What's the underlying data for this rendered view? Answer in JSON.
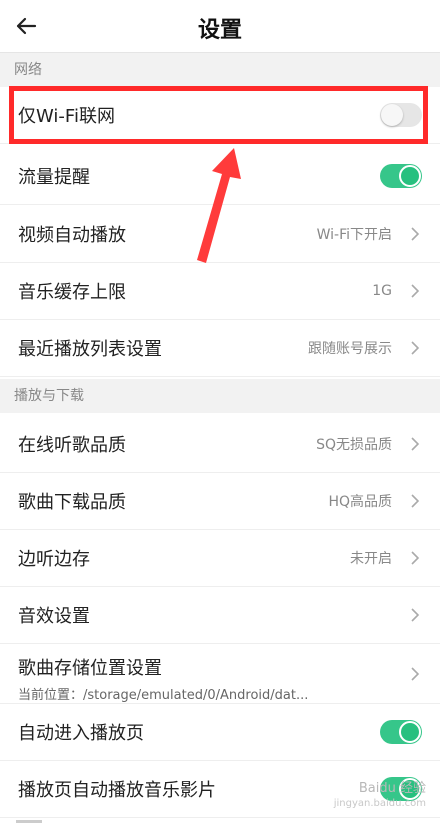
{
  "header": {
    "title": "设置"
  },
  "sections": {
    "network": {
      "label": "网络"
    },
    "playback": {
      "label": "播放与下载"
    }
  },
  "rows": {
    "wifi_only": {
      "label": "仅Wi-Fi联网",
      "toggle": "off"
    },
    "data_alert": {
      "label": "流量提醒",
      "toggle": "on"
    },
    "video_autoplay": {
      "label": "视频自动播放",
      "value": "Wi-Fi下开启"
    },
    "cache_limit": {
      "label": "音乐缓存上限",
      "value": "1G"
    },
    "recent_list": {
      "label": "最近播放列表设置",
      "value": "跟随账号展示"
    },
    "online_quality": {
      "label": "在线听歌品质",
      "value": "SQ无损品质"
    },
    "download_quality": {
      "label": "歌曲下载品质",
      "value": "HQ高品质"
    },
    "cache_while_play": {
      "label": "边听边存",
      "value": "未开启"
    },
    "sound_effects": {
      "label": "音效设置"
    },
    "storage_location": {
      "label": "歌曲存储位置设置",
      "sub": "当前位置：/storage/emulated/0/Android/dat..."
    },
    "auto_enter_player": {
      "label": "自动进入播放页",
      "toggle": "on"
    },
    "auto_play_video": {
      "label": "播放页自动播放音乐影片",
      "toggle": "on"
    }
  },
  "watermark": {
    "text": "Baidu 经验",
    "sub": "jingyan.baidu.com"
  },
  "colors": {
    "accent": "#36c68a",
    "highlight": "#ff2a2a",
    "arrow": "#ff3b3b"
  }
}
